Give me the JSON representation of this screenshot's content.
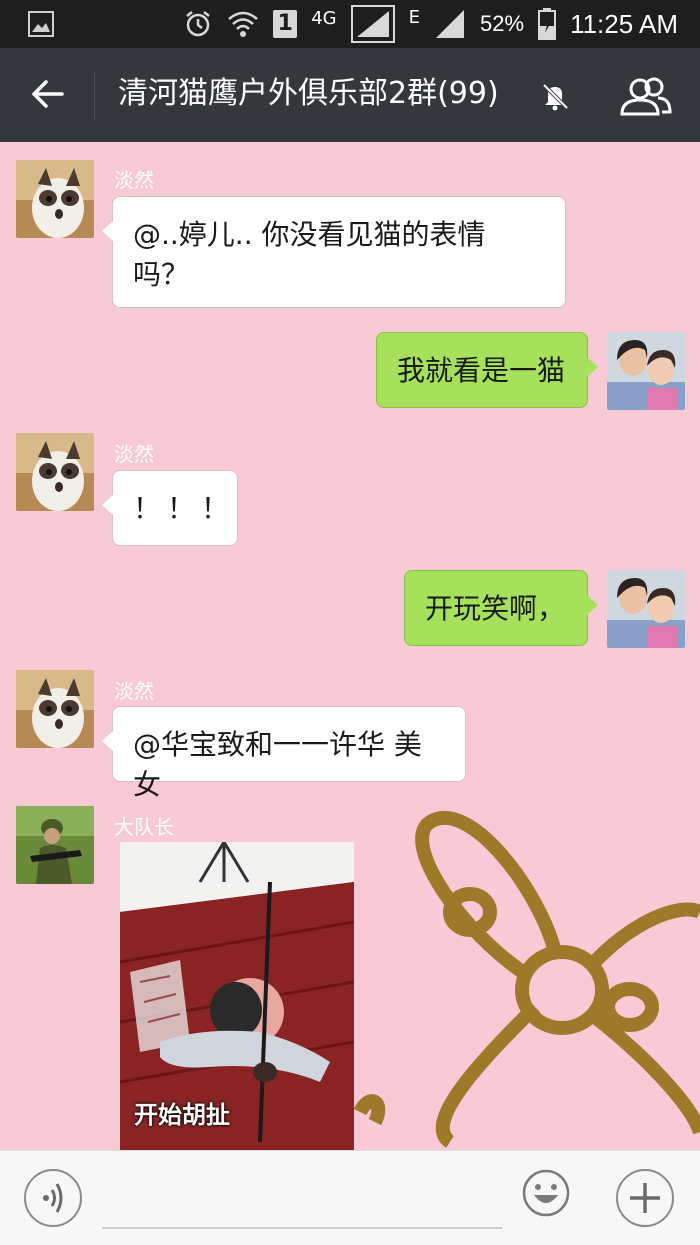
{
  "status_bar": {
    "left_icon": "gallery-icon",
    "icons": [
      "alarm-icon",
      "wifi-icon",
      "sim1-icon",
      "signal-icon",
      "signal-icon"
    ],
    "network_4g": "4G",
    "network_e": "E",
    "sim": "1",
    "battery": "52%",
    "time": "11:25 AM"
  },
  "header": {
    "title": "清河猫鹰户外俱乐部2群(99)",
    "back_icon": "back-arrow-icon",
    "mute_icon": "bell-off-icon",
    "members_icon": "members-icon",
    "bg_color": "#34373c"
  },
  "chat": {
    "bg_color": "#f8cad6",
    "messages": [
      {
        "sender": "淡然",
        "direction": "in",
        "text": "@..婷儿.. 你没看见猫的表情吗？",
        "line1": "@..婷儿.. 你没看见猫的表情",
        "line2": "吗？",
        "avatar": "cat-avatar"
      },
      {
        "direction": "out",
        "text": "我就看是一猫",
        "avatar": "selfie-avatar"
      },
      {
        "sender": "淡然",
        "direction": "in",
        "text": "！！！",
        "avatar": "cat-avatar"
      },
      {
        "direction": "out",
        "text": "开玩笑啊，",
        "avatar": "selfie-avatar"
      },
      {
        "sender": "淡然",
        "direction": "in",
        "text": "@华宝致和一一许华 美女",
        "avatar": "cat-avatar"
      },
      {
        "sender": "大队长",
        "direction": "in",
        "type": "gif",
        "caption": "开始胡扯",
        "avatar": "soldier-avatar"
      }
    ],
    "bubble_colors": {
      "in": "#ffffff",
      "out": "#a6e15c"
    }
  },
  "input_bar": {
    "voice_icon": "voice-icon",
    "emoji_icon": "emoji-icon",
    "plus_icon": "plus-icon",
    "text_value": ""
  }
}
